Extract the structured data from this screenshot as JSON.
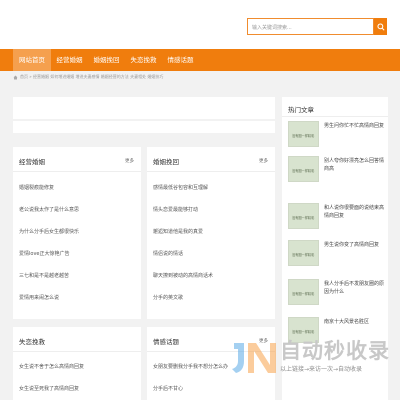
{
  "search": {
    "placeholder": "输入关键词搜索..."
  },
  "nav": {
    "items": [
      {
        "label": "网站首页"
      },
      {
        "label": "经营婚姻"
      },
      {
        "label": "婚姻挽回"
      },
      {
        "label": "失恋挽救"
      },
      {
        "label": "情感话题"
      }
    ]
  },
  "breadcrumb": {
    "text": "首页 » 经营婚姻 如何增进婚姻 增进夫妻感情 婚姻经营的方法 夫妻相处 婚姻技巧"
  },
  "sections": [
    {
      "title": "经营婚姻",
      "more": "更多",
      "items": [
        "婚姻裂痕能修复",
        "老公说我太作了是什么意思",
        "为什么分手后女生都很快乐",
        "爱情love正大惊艳广告",
        "三七和是不是越老越苦",
        "爱情用来闹怎么说"
      ]
    },
    {
      "title": "婚姻挽回",
      "more": "更多",
      "items": [
        "感情最低谷包容和互理解",
        "情头恋爱最能够打动",
        "邂逅知道他是我的真爱",
        "情侣说的情话",
        "聊天撩到被动的高情商话术",
        "分手的英文歌"
      ]
    },
    {
      "title": "失恋挽救",
      "more": "",
      "items": [
        "女生说不舍于怎么高情商回复",
        "女生说至死我了高情商回复"
      ]
    },
    {
      "title": "情感话题",
      "more": "更多",
      "items": [
        "女朋友要删我分手我不想分怎么办",
        "分手后不甘心"
      ]
    }
  ],
  "sidebar": {
    "title": "热门文章",
    "thumb_label": "没有图一样精彩",
    "items": [
      "男生问你忙不忙高情商回复",
      "别人夸你好漂亮怎么回答情商高",
      "和人说你很要面的说结束高情商回复",
      "男生说你变了高情商回复",
      "我人分手后不发朋友圈的原因为什么",
      "南京十大风景名胜区"
    ]
  },
  "watermark": {
    "title": "自动秒收录",
    "subtitle": "以上链接→来访一次→自动收录"
  }
}
